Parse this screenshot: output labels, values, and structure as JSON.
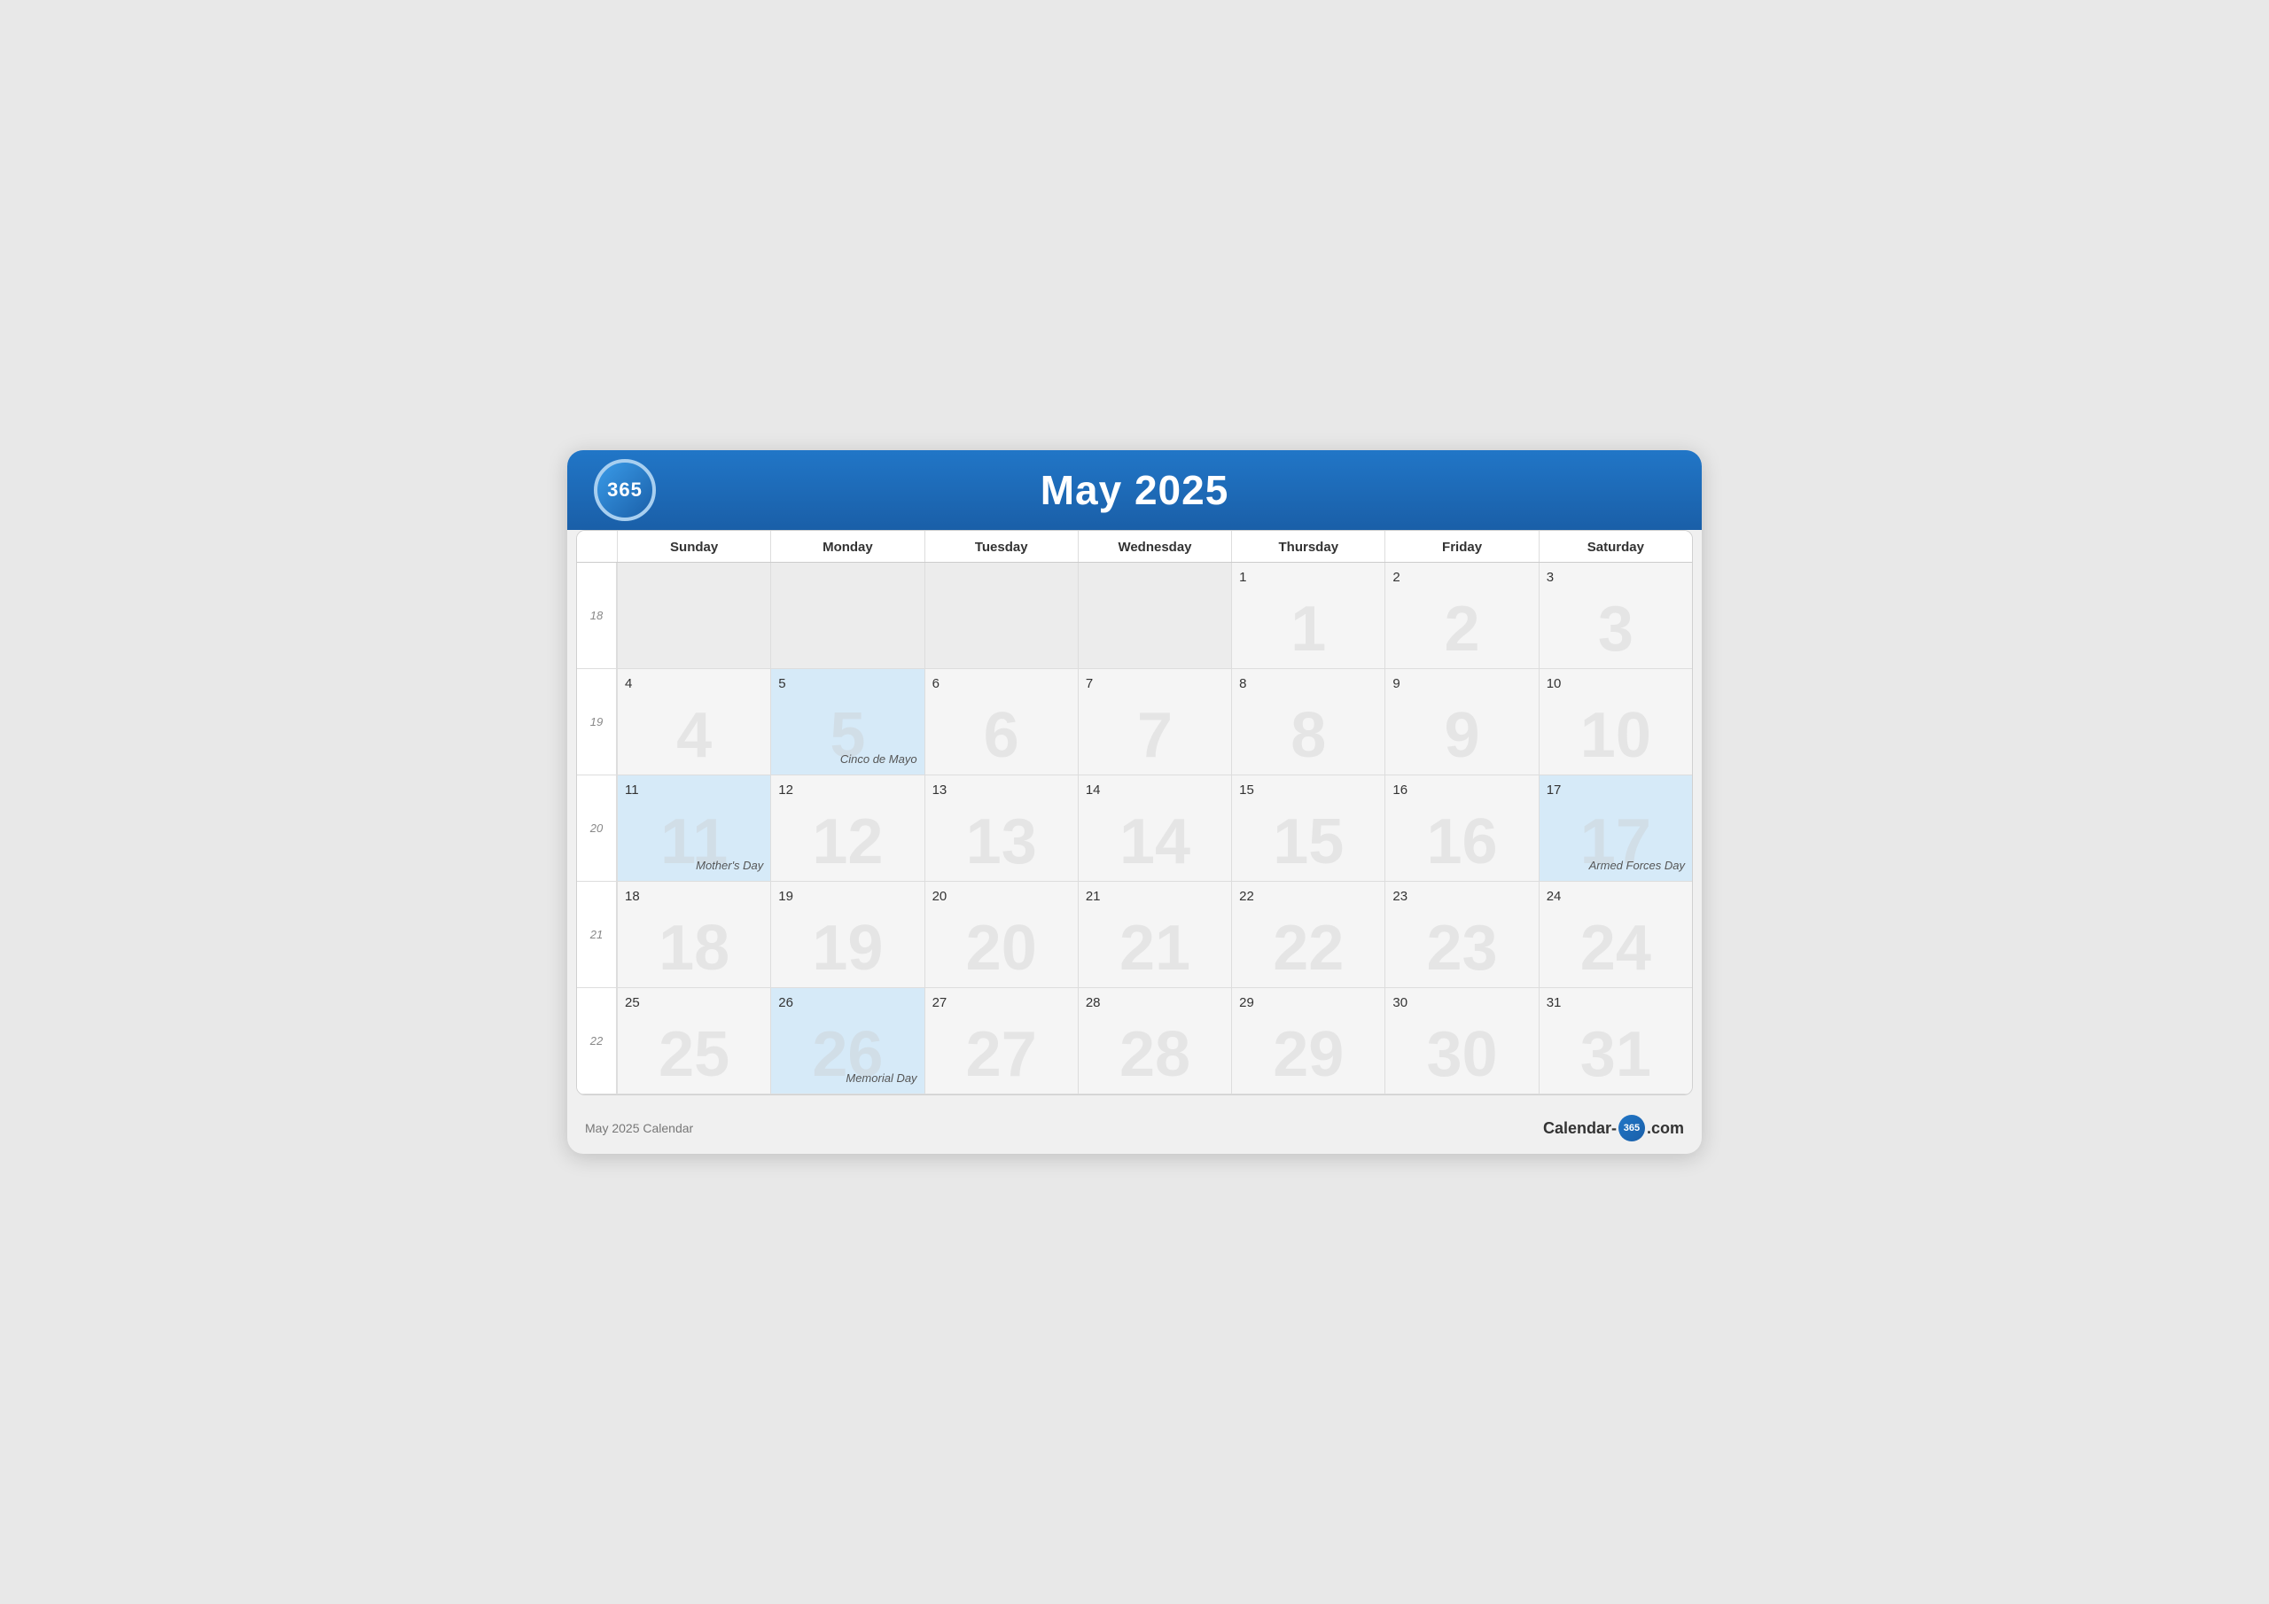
{
  "header": {
    "logo": "365",
    "title": "May 2025"
  },
  "days_of_week": [
    "Sunday",
    "Monday",
    "Tuesday",
    "Wednesday",
    "Thursday",
    "Friday",
    "Saturday"
  ],
  "weeks": [
    {
      "week_num": 18,
      "days": [
        {
          "date": "",
          "type": "prev-month",
          "bg": "",
          "event": ""
        },
        {
          "date": "",
          "type": "prev-month",
          "bg": "",
          "event": ""
        },
        {
          "date": "",
          "type": "prev-month",
          "bg": "",
          "event": ""
        },
        {
          "date": "",
          "type": "prev-month",
          "bg": "",
          "event": ""
        },
        {
          "date": "1",
          "type": "current-month",
          "bg": "1",
          "event": ""
        },
        {
          "date": "2",
          "type": "current-month",
          "bg": "2",
          "event": ""
        },
        {
          "date": "3",
          "type": "current-month",
          "bg": "3",
          "event": ""
        }
      ]
    },
    {
      "week_num": 19,
      "days": [
        {
          "date": "4",
          "type": "current-month",
          "bg": "4",
          "event": ""
        },
        {
          "date": "5",
          "type": "highlighted",
          "bg": "5",
          "event": "Cinco de Mayo"
        },
        {
          "date": "6",
          "type": "current-month",
          "bg": "6",
          "event": ""
        },
        {
          "date": "7",
          "type": "current-month",
          "bg": "7",
          "event": ""
        },
        {
          "date": "8",
          "type": "current-month",
          "bg": "8",
          "event": ""
        },
        {
          "date": "9",
          "type": "current-month",
          "bg": "9",
          "event": ""
        },
        {
          "date": "10",
          "type": "current-month",
          "bg": "10",
          "event": ""
        }
      ]
    },
    {
      "week_num": 20,
      "days": [
        {
          "date": "11",
          "type": "highlighted",
          "bg": "11",
          "event": "Mother's Day"
        },
        {
          "date": "12",
          "type": "current-month",
          "bg": "12",
          "event": ""
        },
        {
          "date": "13",
          "type": "current-month",
          "bg": "13",
          "event": ""
        },
        {
          "date": "14",
          "type": "current-month",
          "bg": "14",
          "event": ""
        },
        {
          "date": "15",
          "type": "current-month",
          "bg": "15",
          "event": ""
        },
        {
          "date": "16",
          "type": "current-month",
          "bg": "16",
          "event": ""
        },
        {
          "date": "17",
          "type": "highlighted",
          "bg": "17",
          "event": "Armed Forces Day"
        }
      ]
    },
    {
      "week_num": 21,
      "days": [
        {
          "date": "18",
          "type": "current-month",
          "bg": "18",
          "event": ""
        },
        {
          "date": "19",
          "type": "current-month",
          "bg": "19",
          "event": ""
        },
        {
          "date": "20",
          "type": "current-month",
          "bg": "20",
          "event": ""
        },
        {
          "date": "21",
          "type": "current-month",
          "bg": "21",
          "event": ""
        },
        {
          "date": "22",
          "type": "current-month",
          "bg": "22",
          "event": ""
        },
        {
          "date": "23",
          "type": "current-month",
          "bg": "23",
          "event": ""
        },
        {
          "date": "24",
          "type": "current-month",
          "bg": "24",
          "event": ""
        }
      ]
    },
    {
      "week_num": 22,
      "days": [
        {
          "date": "25",
          "type": "current-month",
          "bg": "25",
          "event": ""
        },
        {
          "date": "26",
          "type": "highlighted",
          "bg": "26",
          "event": "Memorial Day"
        },
        {
          "date": "27",
          "type": "current-month",
          "bg": "27",
          "event": ""
        },
        {
          "date": "28",
          "type": "current-month",
          "bg": "28",
          "event": ""
        },
        {
          "date": "29",
          "type": "current-month",
          "bg": "29",
          "event": ""
        },
        {
          "date": "30",
          "type": "current-month",
          "bg": "30",
          "event": ""
        },
        {
          "date": "31",
          "type": "current-month",
          "bg": "31",
          "event": ""
        }
      ]
    }
  ],
  "footer": {
    "left": "May 2025 Calendar",
    "right_prefix": "Calendar-",
    "right_num": "365",
    "right_suffix": ".com"
  }
}
